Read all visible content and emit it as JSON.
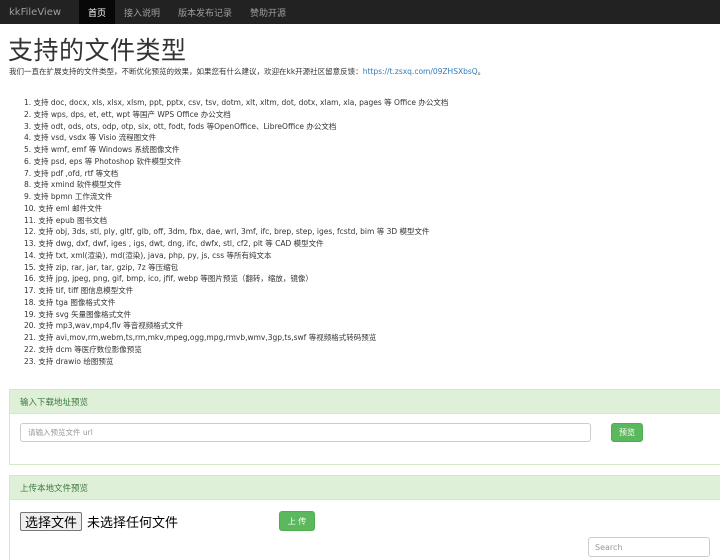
{
  "navbar": {
    "brand": "kkFileView",
    "items": [
      {
        "label": "首页",
        "active": true
      },
      {
        "label": "接入说明",
        "active": false
      },
      {
        "label": "版本发布记录",
        "active": false
      },
      {
        "label": "赞助开源",
        "active": false
      }
    ]
  },
  "page": {
    "title": "支持的文件类型",
    "intro_text": "我们一直在扩展支持的文件类型，不断优化预览的效果，如果您有什么建议，欢迎在kk开源社区留意反馈：",
    "intro_link": "https://t.zsxq.com/09ZHSXbsQ",
    "intro_suffix": "。"
  },
  "types": [
    "1. 支持 doc, docx, xls, xlsx, xlsm, ppt, pptx, csv, tsv, dotm, xlt, xltm, dot, dotx, xlam, xla, pages 等 Office 办公文档",
    "2. 支持 wps, dps, et, ett, wpt 等国产 WPS Office 办公文档",
    "3. 支持 odt, ods, ots, odp, otp, six, ott, fodt, fods 等OpenOffice、LibreOffice 办公文档",
    "4. 支持 vsd, vsdx 等 Visio 流程图文件",
    "5. 支持 wmf, emf 等 Windows 系统图像文件",
    "6. 支持 psd, eps 等 Photoshop 软件模型文件",
    "7. 支持 pdf ,ofd, rtf 等文档",
    "8. 支持 xmind 软件模型文件",
    "9. 支持 bpmn 工作流文件",
    "10. 支持 eml 邮件文件",
    "11. 支持 epub 图书文档",
    "12. 支持 obj, 3ds, stl, ply, gltf, glb, off, 3dm, fbx, dae, wrl, 3mf, ifc, brep, step, iges, fcstd, bim 等 3D 模型文件",
    "13. 支持 dwg, dxf, dwf, iges , igs, dwt, dng, ifc, dwfx, stl, cf2, plt 等 CAD 模型文件",
    "14. 支持 txt, xml(渲染), md(渲染), java, php, py, js, css 等所有纯文本",
    "15. 支持 zip, rar, jar, tar, gzip, 7z 等压缩包",
    "16. 支持 jpg, jpeg, png, gif, bmp, ico, jfif, webp 等图片预览（翻转，缩放，镜像）",
    "17. 支持 tif, tiff 图信息模型文件",
    "18. 支持 tga 图像格式文件",
    "19. 支持 svg 矢量图像格式文件",
    "20. 支持 mp3,wav,mp4,flv 等音视频格式文件",
    "21. 支持 avi,mov,rm,webm,ts,rm,mkv,mpeg,ogg,mpg,rmvb,wmv,3gp,ts,swf 等视频格式转码预览",
    "22. 支持 dcm 等医疗数位影像预览",
    "23. 支持 drawio 绘图预览"
  ],
  "url_panel": {
    "heading": "输入下载地址预览",
    "placeholder": "请输入预览文件 url",
    "button": "预览"
  },
  "upload_panel": {
    "heading": "上传本地文件预览",
    "choose_button": "选择文件",
    "file_status": "未选择任何文件",
    "upload_button": "上 传"
  },
  "search": {
    "placeholder": "Search"
  },
  "colors": {
    "navbar_bg": "#222222",
    "accent_green": "#5cb85c",
    "panel_heading_bg": "#dff0d8",
    "link": "#337ab7"
  }
}
